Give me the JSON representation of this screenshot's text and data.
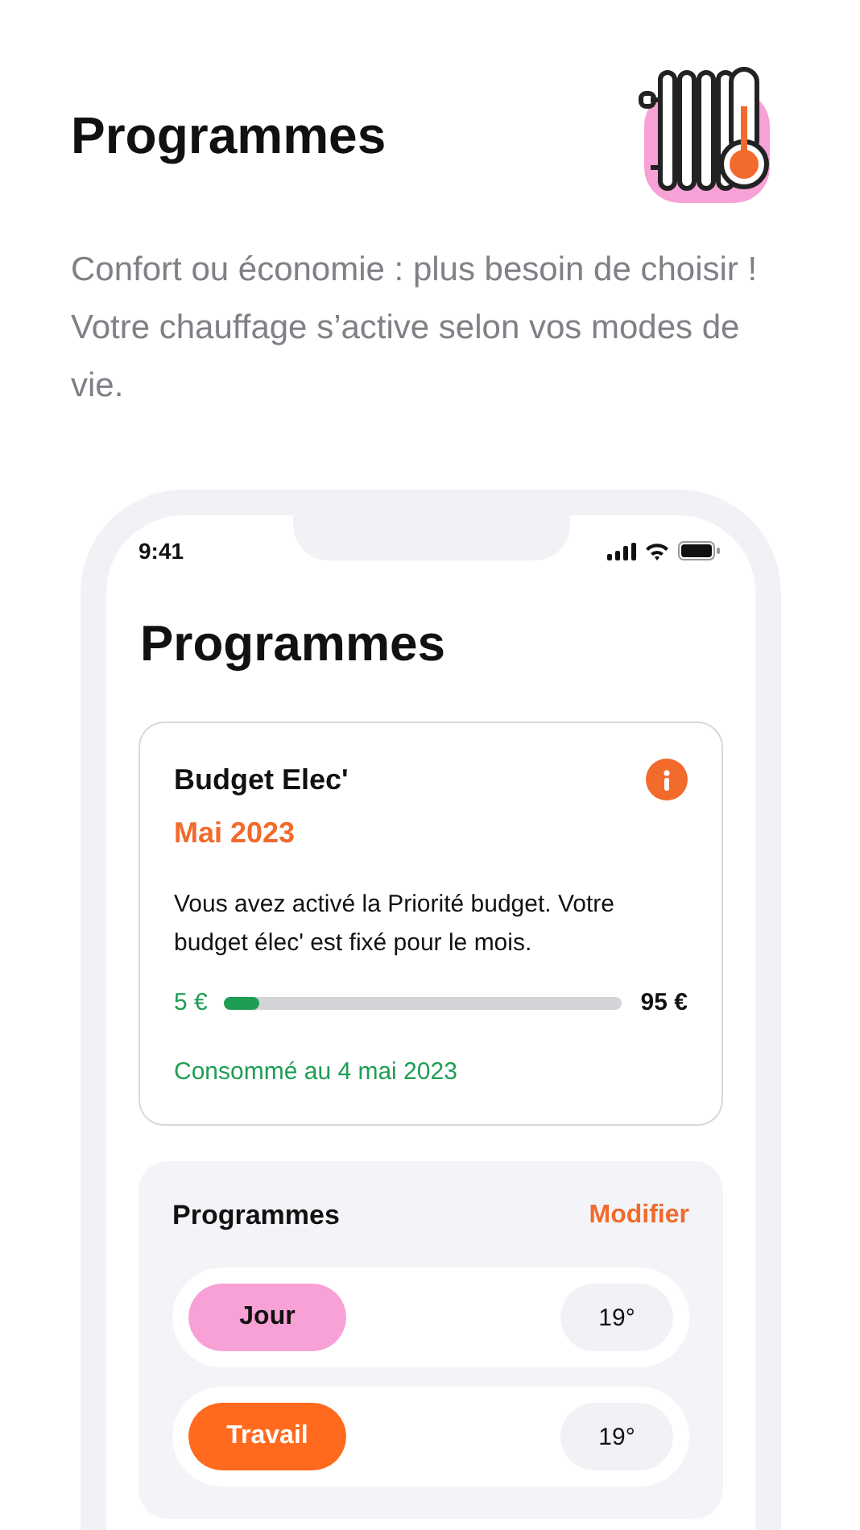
{
  "header": {
    "title": "Programmes",
    "description": "Confort ou économie : plus besoin de choisir ! Votre chauffage s’active selon vos modes de vie."
  },
  "phone": {
    "status_bar": {
      "time": "9:41"
    },
    "title": "Programmes",
    "budget_card": {
      "title": "Budget Elec'",
      "month": "Mai 2023",
      "text": "Vous avez activé la Priorité budget. Votre budget élec' est fixé pour le mois.",
      "consumed": "5 €",
      "level": 0.09,
      "budget": "95 €",
      "note": "Consommé au 4 mai 2023"
    },
    "programs": {
      "title": "Programmes",
      "action": "Modifier",
      "items": [
        {
          "name": "Jour",
          "color": "#f7a1d6",
          "temperature": "19°"
        },
        {
          "name": "Travail",
          "color": "#ff6a1f",
          "temperature": "19°"
        }
      ]
    }
  }
}
